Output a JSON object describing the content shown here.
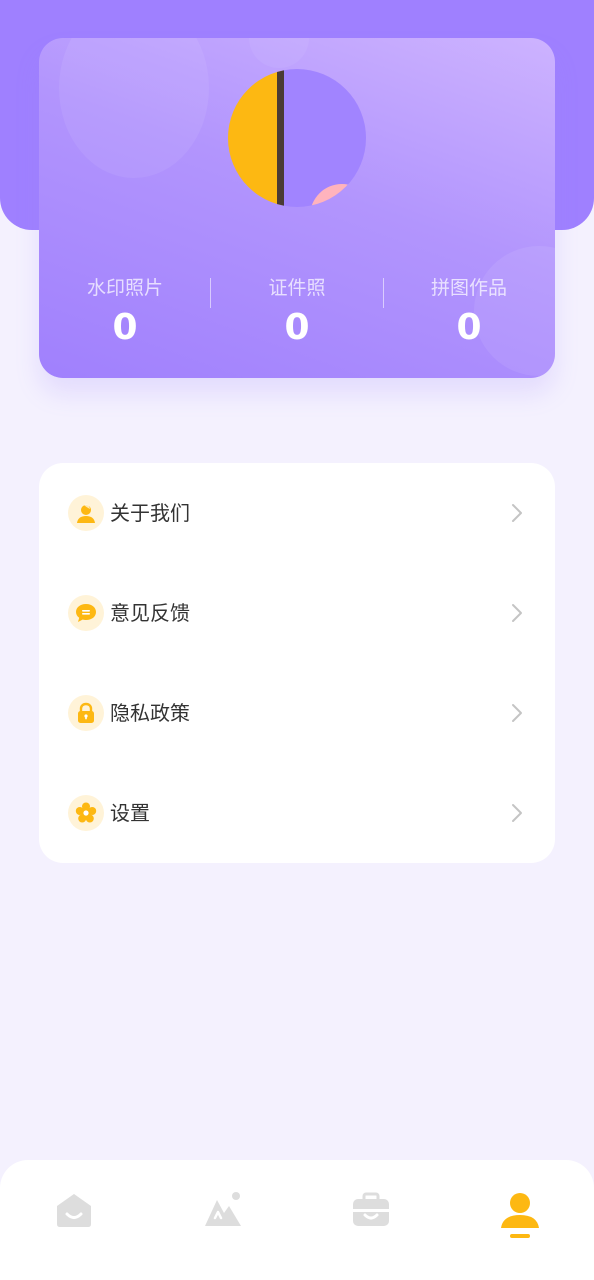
{
  "profile": {
    "stats": [
      {
        "label": "水印照片",
        "value": "0"
      },
      {
        "label": "证件照",
        "value": "0"
      },
      {
        "label": "拼图作品",
        "value": "0"
      }
    ]
  },
  "menu": {
    "items": [
      {
        "label": "关于我们",
        "icon": "about-user-icon"
      },
      {
        "label": "意见反馈",
        "icon": "feedback-chat-icon"
      },
      {
        "label": "隐私政策",
        "icon": "lock-icon"
      },
      {
        "label": "设置",
        "icon": "settings-flower-icon"
      }
    ]
  },
  "tabbar": {
    "tabs": [
      {
        "icon": "home-icon",
        "active": false
      },
      {
        "icon": "gallery-icon",
        "active": false
      },
      {
        "icon": "toolbox-icon",
        "active": false
      },
      {
        "icon": "profile-icon",
        "active": true
      }
    ]
  },
  "colors": {
    "accent_purple": "#9F80FF",
    "accent_yellow": "#FDB812",
    "background": "#F4F1FE",
    "inactive_icon": "#DDDDDD"
  }
}
